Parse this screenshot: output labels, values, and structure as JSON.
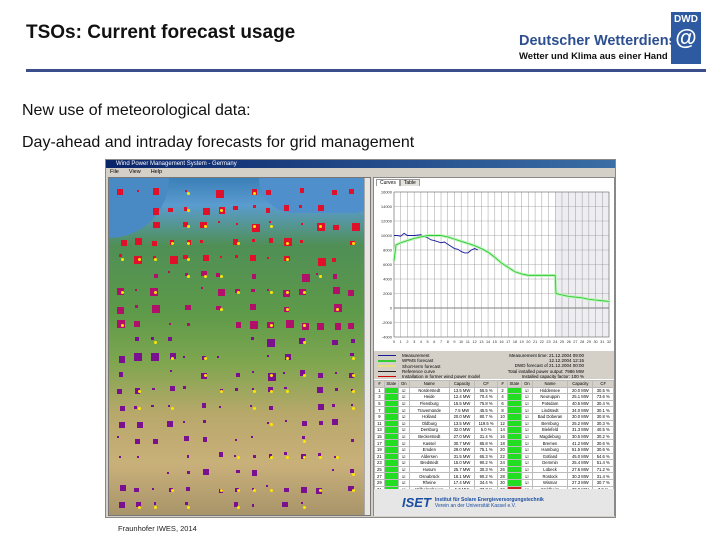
{
  "slide": {
    "title": "TSOs: Current forecast usage",
    "line1": "New use of meteorological data:",
    "line2": "Day-ahead and intraday forecasts for grid management",
    "caption": "Fraunhofer IWES, 2014"
  },
  "logo": {
    "name": "Deutscher Wetterdienst",
    "tagline": "Wetter und Klima aus einer Hand",
    "abbr": "DWD"
  },
  "window": {
    "title": "Wind Power Management System - Germany",
    "menu": [
      "File",
      "View",
      "Help"
    ],
    "tabs": [
      "Curves",
      "Table"
    ]
  },
  "legend": {
    "items": [
      {
        "label": "Measurement",
        "color": "#1a1a9a"
      },
      {
        "label": "WPMS forecast",
        "color": "#33cc33"
      },
      {
        "label": "Short-term forecast",
        "color": "#e8e080"
      },
      {
        "label": "Reference curve",
        "color": "#222222"
      },
      {
        "label": "Installation in former wind power model",
        "color": "#cc0000"
      }
    ],
    "info": [
      "Measurement time: 21.12.2004 09:00",
      "12.12.2004 12:15",
      "DWD forecast of 21.12.2004 00:00",
      "Total installed power output: 7986 MW",
      "Installed capacity factor: 100 %"
    ]
  },
  "table": {
    "headers": [
      "#",
      "State",
      "On",
      "Name",
      "Capacity",
      "CF",
      "#",
      "State",
      "On",
      "Name",
      "Capacity",
      "CF"
    ],
    "rows": [
      [
        "1",
        "green",
        "☑",
        "Norderstedt",
        "13.5 MW",
        "55.5 %",
        "2",
        "green",
        "☑",
        "Hiddensee",
        "20.0 MW",
        "30.5 %"
      ],
      [
        "3",
        "green",
        "☑",
        "Heide",
        "12.4 MW",
        "70.4 %",
        "4",
        "green",
        "☑",
        "Neuruppin",
        "25.1 MW",
        "73.6 %"
      ],
      [
        "5",
        "green",
        "☑",
        "Flensburg",
        "15.5 MW",
        "75.8 %",
        "6",
        "green",
        "☑",
        "Potsdam",
        "40.5 MW",
        "30.4 %"
      ],
      [
        "7",
        "green",
        "☑",
        "Travemünde",
        "7.5 MW",
        "45.5 %",
        "8",
        "green",
        "☑",
        "Lindstedt",
        "34.0 MW",
        "30.1 %"
      ],
      [
        "9",
        "green",
        "☑",
        "Holland",
        "20.0 MW",
        "80.7 %",
        "10",
        "green",
        "☑",
        "Bad Doberan",
        "30.0 MW",
        "30.8 %"
      ],
      [
        "11",
        "green",
        "☑",
        "Oldburg",
        "13.5 MW",
        "119.5 %",
        "12",
        "green",
        "☑",
        "Bernburg",
        "25.2 MW",
        "30.3 %"
      ],
      [
        "13",
        "green",
        "☑",
        "Dersburg",
        "32.0 MW",
        "5.0 %",
        "14",
        "green",
        "☑",
        "Bielefeld",
        "31.3 MW",
        "40.5 %"
      ],
      [
        "15",
        "green",
        "☑",
        "Beckerstedt",
        "27.0 MW",
        "31.4 %",
        "16",
        "green",
        "☑",
        "Magdeburg",
        "30.5 MW",
        "30.2 %"
      ],
      [
        "17",
        "green",
        "☑",
        "Kassel",
        "30.7 MW",
        "85.8 %",
        "18",
        "green",
        "☑",
        "Bremen",
        "41.2 MW",
        "30.6 %"
      ],
      [
        "19",
        "green",
        "☑",
        "Emden",
        "29.0 MW",
        "75.1 %",
        "20",
        "green",
        "☑",
        "Hamburg",
        "51.5 MW",
        "30.6 %"
      ],
      [
        "21",
        "green",
        "☑",
        "Aldersen",
        "31.5 MW",
        "65.3 %",
        "22",
        "green",
        "☑",
        "Gotland",
        "45.0 MW",
        "54.6 %"
      ],
      [
        "23",
        "green",
        "☑",
        "Bredstedt",
        "15.0 MW",
        "90.2 %",
        "24",
        "green",
        "☑",
        "Demmin",
        "25.4 MW",
        "51.4 %"
      ],
      [
        "25",
        "green",
        "☑",
        "Husum",
        "25.7 MW",
        "30.3 %",
        "26",
        "green",
        "☑",
        "Lübeck",
        "27.6 MW",
        "71.2 %"
      ],
      [
        "27",
        "green",
        "☑",
        "Osnabrück",
        "18.1 MW",
        "90.2 %",
        "28",
        "green",
        "☑",
        "Rostock",
        "30.3 MW",
        "31.4 %"
      ],
      [
        "29",
        "green",
        "☑",
        "Rheine",
        "17.4 MW",
        "34.4 %",
        "30",
        "green",
        "☑",
        "Wismar",
        "27.3 MW",
        "30.7 %"
      ],
      [
        "31",
        "green",
        "☑",
        "Wilhelmshaven",
        "5.7 MW",
        "77.7 %",
        "32",
        "red",
        "☑",
        "Waldheim",
        "30.0 MW",
        "7.0 %"
      ]
    ]
  },
  "iset": {
    "abbr": "ISET",
    "line1": "Institut für Solare Energieversorgungstechnik",
    "line2": "Verein an der Universität Kassel e.V."
  },
  "colors": {
    "accent": "#3a4f8c",
    "ok": "#22dd22",
    "alarm": "#cc2222"
  },
  "chart_data": {
    "type": "line",
    "title": "",
    "xlabel": "",
    "ylabel": "",
    "xlim": [
      0,
      32
    ],
    "ylim": [
      -4000,
      16000
    ],
    "yticks": [
      16000,
      14000,
      12000,
      10000,
      8000,
      6000,
      4000,
      2000,
      0,
      -2000,
      -4000
    ],
    "xticks": [
      0,
      1,
      2,
      3,
      4,
      5,
      6,
      7,
      8,
      9,
      10,
      11,
      12,
      13,
      14,
      15,
      16,
      17,
      18,
      19,
      20,
      21,
      22,
      23,
      24,
      25,
      26,
      27,
      28,
      29,
      30,
      31,
      32
    ],
    "shaded_from": 24,
    "series": [
      {
        "name": "Measurement",
        "color": "#1a1a9a",
        "x": [
          0,
          0.5,
          1,
          1.5,
          2,
          3,
          4,
          4.5,
          5,
          5.5,
          6,
          7,
          7.5,
          8,
          9,
          9.5,
          10,
          10.5,
          11,
          11.5,
          12,
          12.5
        ],
        "y": [
          10000,
          10000,
          9900,
          10300,
          10000,
          10000,
          10100,
          9800,
          9700,
          9400,
          9300,
          9000,
          9100,
          8800,
          8200,
          8100,
          7800,
          7600,
          7600,
          8000,
          8200,
          8000
        ]
      },
      {
        "name": "WPMS forecast",
        "color": "#33cc33",
        "x": [
          0,
          0.3,
          1,
          2,
          3,
          4,
          5,
          6,
          7,
          8,
          9,
          10,
          11,
          12,
          13,
          14,
          15,
          16,
          17,
          18,
          19,
          20,
          21,
          22,
          23,
          24,
          24.1,
          25,
          26,
          27,
          28,
          29,
          30,
          31,
          32
        ],
        "y": [
          6500,
          8700,
          9000,
          9300,
          9600,
          9800,
          10000,
          10000,
          10000,
          9800,
          9500,
          9200,
          8900,
          8600,
          8200,
          7700,
          7000,
          6200,
          5600,
          5000,
          4700,
          4500,
          4500,
          4500,
          4500,
          4500,
          2000,
          1800,
          1600,
          1500,
          1400,
          1200,
          1100,
          1000,
          900
        ]
      }
    ]
  }
}
